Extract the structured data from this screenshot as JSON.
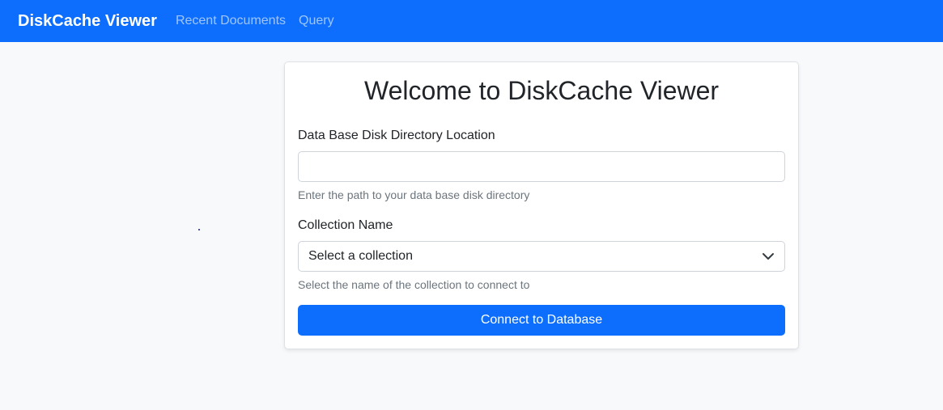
{
  "navbar": {
    "brand": "DiskCache Viewer",
    "links": [
      "Recent Documents",
      "Query"
    ]
  },
  "card": {
    "title": "Welcome to DiskCache Viewer",
    "directory": {
      "label": "Data Base Disk Directory Location",
      "value": "",
      "help": "Enter the path to your data base disk directory"
    },
    "collection": {
      "label": "Collection Name",
      "selected": "Select a collection",
      "help": "Select the name of the collection to connect to"
    },
    "connect_label": "Connect to Database"
  },
  "colors": {
    "primary": "#0d6efd",
    "background": "#f8f9fa",
    "muted_text": "#6c757d"
  },
  "icons": {
    "select_arrow": "chevron-down-icon"
  }
}
